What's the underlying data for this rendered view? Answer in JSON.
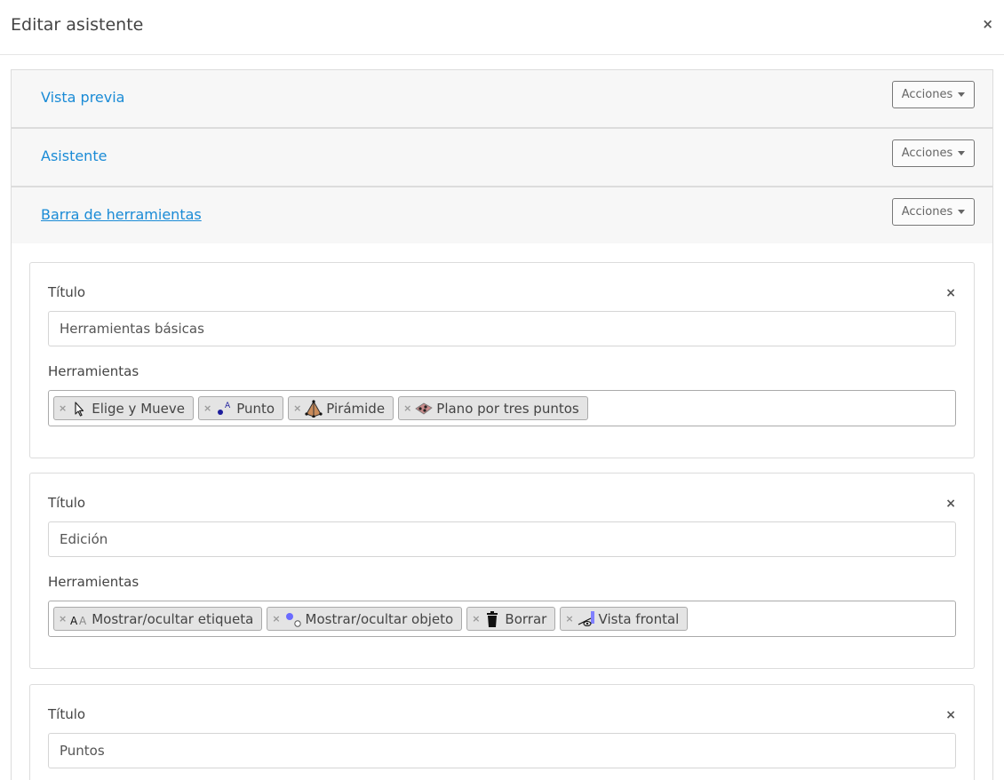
{
  "modal": {
    "title": "Editar asistente",
    "close_symbol": "×"
  },
  "accordion": [
    {
      "title": "Vista previa",
      "actions_label": "Acciones"
    },
    {
      "title": "Asistente",
      "actions_label": "Acciones"
    },
    {
      "title": "Barra de herramientas",
      "actions_label": "Acciones"
    }
  ],
  "toolbar_groups": [
    {
      "title_label": "Título",
      "title_value": "Herramientas básicas",
      "tools_label": "Herramientas",
      "tools": [
        {
          "label": "Elige y Mueve",
          "icon": "pointer-icon"
        },
        {
          "label": "Punto",
          "icon": "point-icon"
        },
        {
          "label": "Pirámide",
          "icon": "pyramid-icon"
        },
        {
          "label": "Plano por tres puntos",
          "icon": "plane-three-points-icon"
        }
      ]
    },
    {
      "title_label": "Título",
      "title_value": "Edición",
      "tools_label": "Herramientas",
      "tools": [
        {
          "label": "Mostrar/ocultar etiqueta",
          "icon": "show-hide-label-icon"
        },
        {
          "label": "Mostrar/ocultar objeto",
          "icon": "show-hide-object-icon"
        },
        {
          "label": "Borrar",
          "icon": "trash-icon"
        },
        {
          "label": "Vista frontal",
          "icon": "front-view-icon"
        }
      ]
    },
    {
      "title_label": "Título",
      "title_value": "Puntos"
    }
  ],
  "tag_remove_symbol": "×",
  "colors": {
    "link": "#1a8bd6",
    "accordion_bg": "#f7f7f7",
    "tag_bg": "#e4e4e4"
  }
}
